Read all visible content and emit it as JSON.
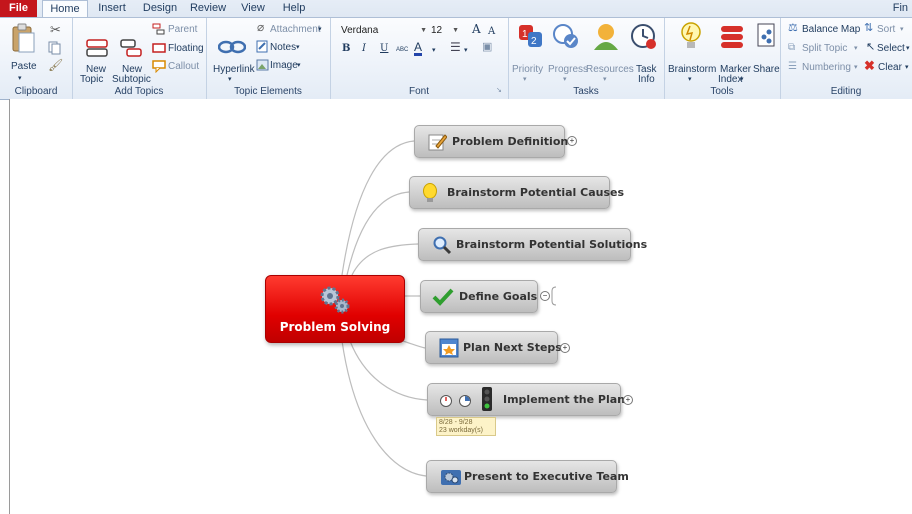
{
  "tabs": {
    "file": "File",
    "home": "Home",
    "insert": "Insert",
    "design": "Design",
    "review": "Review",
    "view": "View",
    "help": "Help",
    "far_right": "Fin"
  },
  "clipboard": {
    "paste": "Paste",
    "group": "Clipboard"
  },
  "add_topics": {
    "new_topic": "New",
    "new_topic_2": "Topic",
    "new_subtopic": "New",
    "new_subtopic_2": "Subtopic",
    "parent": "Parent",
    "floating": "Floating",
    "callout": "Callout",
    "group": "Add Topics"
  },
  "topic_elements": {
    "hyperlink": "Hyperlink",
    "attachment": "Attachment",
    "notes": "Notes",
    "image": "Image",
    "group": "Topic Elements"
  },
  "font": {
    "family": "Verdana",
    "size": "12",
    "group": "Font",
    "bold": "B",
    "italic": "I",
    "underline": "U",
    "smallcaps": "ABC",
    "grow": "A",
    "shrink": "A",
    "color": "A"
  },
  "tasks": {
    "priority": "Priority",
    "progress": "Progress",
    "resources": "Resources",
    "task_info": "Task",
    "task_info_2": "Info",
    "group": "Tasks"
  },
  "tools": {
    "brainstorm": "Brainstorm",
    "marker_index": "Marker",
    "marker_index_2": "Index",
    "share": "Share",
    "group": "Tools"
  },
  "editing": {
    "balance_map": "Balance Map",
    "sort": "Sort",
    "split_topic": "Split Topic",
    "select": "Select",
    "numbering": "Numbering",
    "clear": "Clear",
    "group": "Editing"
  },
  "map": {
    "central": "Problem Solving",
    "topics": [
      "Problem Definition",
      "Brainstorm Potential Causes",
      "Brainstorm Potential Solutions",
      "Define Goals",
      "Plan Next Steps",
      "Implement the Plan",
      "Present to Executive Team"
    ],
    "task_dates": "8/28 - 9/28",
    "task_duration": "23 workday(s)"
  },
  "colors": {
    "file_tab": "#c4161c",
    "central": "#e00000",
    "topic": "#c8c8c8"
  }
}
